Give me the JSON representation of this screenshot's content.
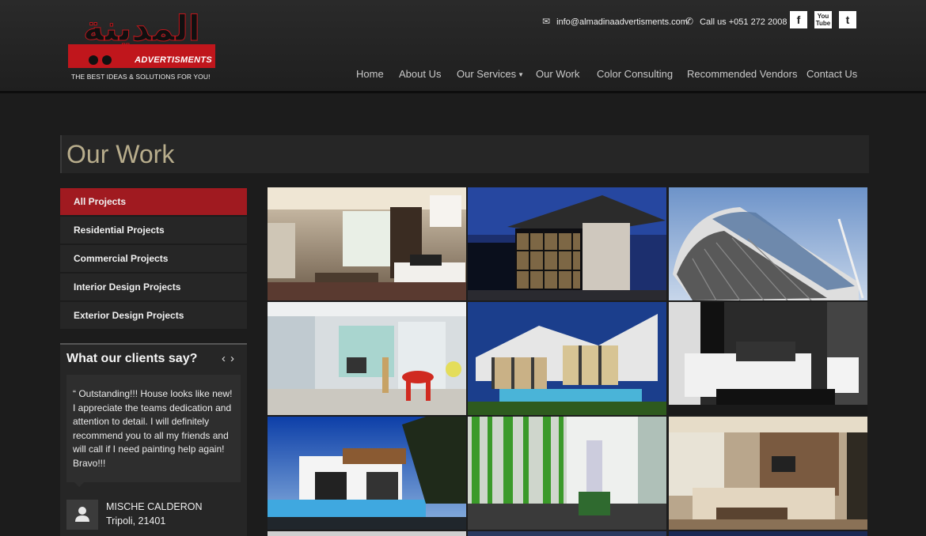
{
  "header": {
    "logo": {
      "arabic_text": "المدينة",
      "brand": "ADVERTISMENTS",
      "tagline": "THE BEST IDEAS & SOLUTIONS FOR YOU!"
    },
    "email": "info@almadinaadvertisments.com",
    "phone": "Call us +051 272 2008",
    "social": [
      "facebook-icon",
      "youtube-icon",
      "twitter-icon"
    ],
    "nav": [
      {
        "label": "Home"
      },
      {
        "label": "About Us"
      },
      {
        "label": "Our Services"
      },
      {
        "label": "Our Work"
      },
      {
        "label": "Color Consulting"
      },
      {
        "label": "Recommended Vendors"
      },
      {
        "label": "Contact Us"
      }
    ]
  },
  "page": {
    "title": "Our Work"
  },
  "filters": [
    {
      "label": "All Projects",
      "active": true
    },
    {
      "label": "Residential Projects"
    },
    {
      "label": "Commercial Projects"
    },
    {
      "label": "Interior Design Projects"
    },
    {
      "label": "Exterior Design Projects"
    }
  ],
  "testimonial": {
    "heading": "What our clients say?",
    "quote": "“ Outstanding!!! House looks like new! I appreciate the teams dedication and attention to detail. I will definitely recommend you to all my friends and will call if I need painting help again! Bravo!!!",
    "name": "MISCHE CALDERON",
    "location": "Tripoli, 21401"
  },
  "colors": {
    "accent_red": "#a01a20",
    "title_color": "#b8ad8c",
    "background": "#1c1c1c"
  },
  "gallery": [
    {
      "icon": "interior-living-room-photo"
    },
    {
      "icon": "modern-house-night-photo"
    },
    {
      "icon": "curved-building-photo"
    },
    {
      "icon": "white-interior-photo"
    },
    {
      "icon": "house-pool-dusk-photo"
    },
    {
      "icon": "white-sofa-photo"
    },
    {
      "icon": "villa-pool-photo"
    },
    {
      "icon": "green-glass-photo"
    },
    {
      "icon": "beige-living-room-photo"
    }
  ]
}
